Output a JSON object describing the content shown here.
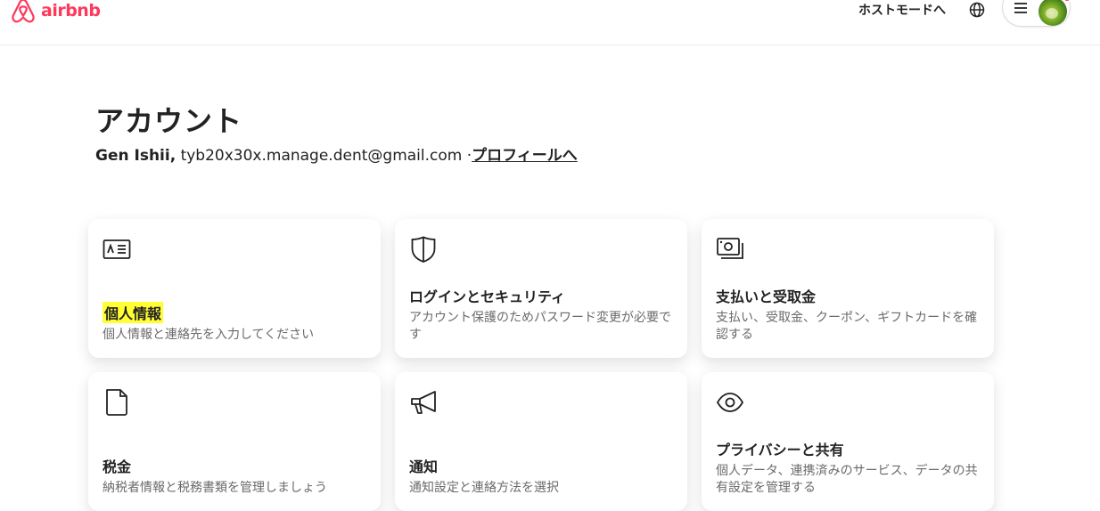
{
  "header": {
    "logo_text": "airbnb",
    "host_mode_label": "ホストモードへ",
    "brand_color": "#ff385c"
  },
  "account": {
    "title": "アカウント",
    "user_name": "Gen Ishii,",
    "email": "tyb20x30x.manage.dent@gmail.com",
    "separator": "·",
    "profile_link": "プロフィールへ"
  },
  "cards": [
    {
      "title": "個人情報",
      "description": "個人情報と連絡先を入力してください",
      "icon": "id-card-icon"
    },
    {
      "title": "ログインとセキュリティ",
      "description": "アカウント保護のためパスワード変更が必要です",
      "icon": "shield-icon"
    },
    {
      "title": "支払いと受取金",
      "description": "支払い、受取金、クーポン、ギフトカードを確認する",
      "icon": "payment-cards-icon"
    },
    {
      "title": "税金",
      "description": "納税者情報と税務書類を管理しましょう",
      "icon": "document-icon"
    },
    {
      "title": "通知",
      "description": "通知設定と連絡方法を選択",
      "icon": "megaphone-icon"
    },
    {
      "title": "プライバシーと共有",
      "description": "個人データ、連携済みのサービス、データの共有設定を管理する",
      "icon": "eye-icon"
    }
  ]
}
